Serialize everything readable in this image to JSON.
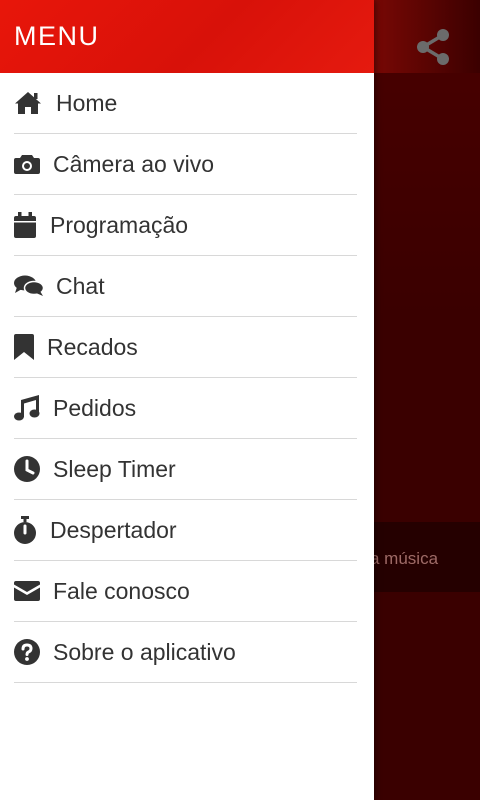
{
  "drawer": {
    "title": "MENU",
    "items": [
      {
        "label": "Home",
        "icon": "home-icon"
      },
      {
        "label": "Câmera ao vivo",
        "icon": "camera-icon"
      },
      {
        "label": "Programação",
        "icon": "calendar-icon"
      },
      {
        "label": "Chat",
        "icon": "chat-icon"
      },
      {
        "label": "Recados",
        "icon": "bookmark-icon"
      },
      {
        "label": "Pedidos",
        "icon": "music-icon"
      },
      {
        "label": "Sleep Timer",
        "icon": "clock-icon"
      },
      {
        "label": "Despertador",
        "icon": "stopwatch-icon"
      },
      {
        "label": "Fale conosco",
        "icon": "envelope-icon"
      },
      {
        "label": "Sobre o aplicativo",
        "icon": "question-circle-icon"
      }
    ]
  },
  "background": {
    "strip_text": "a música",
    "share_icon": "share-icon"
  },
  "colors": {
    "header_red": "#e8160a",
    "icon_dark": "#333333",
    "text_dark": "#333333",
    "divider": "#d8d8d8"
  }
}
